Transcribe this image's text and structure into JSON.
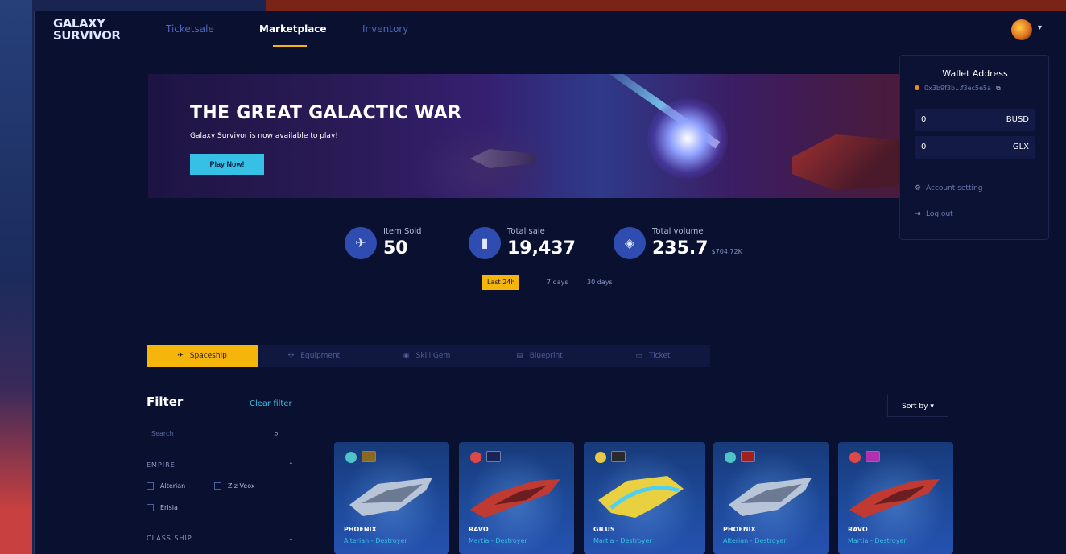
{
  "app": {
    "logo": "GALAXY SURVIVOR"
  },
  "nav": {
    "items": [
      {
        "label": "Ticketsale",
        "active": false
      },
      {
        "label": "Marketplace",
        "active": true
      },
      {
        "label": "Inventory",
        "active": false
      }
    ]
  },
  "banner": {
    "title": "THE GREAT GALACTIC WAR",
    "subtitle": "Galaxy Survivor is now available to play!",
    "button": "Play Now!"
  },
  "wallet": {
    "title": "Wallet Address",
    "address": "0x3b9f3b...f3ec5e5a",
    "balances": [
      {
        "value": "0",
        "unit": "BUSD"
      },
      {
        "value": "0",
        "unit": "GLX"
      }
    ],
    "menu": [
      {
        "label": "Account setting",
        "icon": "gear-icon"
      },
      {
        "label": "Log out",
        "icon": "logout-icon"
      }
    ]
  },
  "stats": [
    {
      "label": "Item Sold",
      "value": "50",
      "sub": "",
      "icon": "spaceship-icon"
    },
    {
      "label": "Total sale",
      "value": "19,437",
      "sub": "",
      "icon": "chart-icon"
    },
    {
      "label": "Total volume",
      "value": "235.7",
      "sub": "$704.72K",
      "icon": "bnb-icon"
    }
  ],
  "time_tabs": [
    {
      "label": "Last 24h",
      "active": true
    },
    {
      "label": "7 days",
      "active": false
    },
    {
      "label": "30 days",
      "active": false
    }
  ],
  "categories": [
    {
      "label": "Spaceship",
      "icon": "spaceship-icon",
      "active": true
    },
    {
      "label": "Equipment",
      "icon": "equipment-icon",
      "active": false
    },
    {
      "label": "Skill Gem",
      "icon": "gem-icon",
      "active": false
    },
    {
      "label": "Blueprint",
      "icon": "blueprint-icon",
      "active": false
    },
    {
      "label": "Ticket",
      "icon": "ticket-icon",
      "active": false
    }
  ],
  "filter": {
    "title": "Filter",
    "clear": "Clear filter",
    "search_placeholder": "Search",
    "sections": [
      {
        "label": "EMPIRE"
      },
      {
        "label": "CLASS SHIP"
      }
    ],
    "checkboxes": [
      {
        "label": "Alterian"
      },
      {
        "label": "Ziz Veox"
      },
      {
        "label": "Erisia"
      }
    ]
  },
  "sort": {
    "label": "Sort by"
  },
  "colors": {
    "accent": "#f5b50a",
    "cyan": "#37c0e6",
    "bg": "#0a1030",
    "card": "#1e4a9a"
  },
  "cards": [
    {
      "name": "PHOENIX",
      "class": "Alterian - Destroyer",
      "element_color": "#4fc3c8",
      "hull": "#b8c4d8"
    },
    {
      "name": "RAVO",
      "class": "Martia - Destroyer",
      "element_color": "#e04848",
      "hull": "#c03a32"
    },
    {
      "name": "GILUS",
      "class": "Martia - Destroyer",
      "element_color": "#e8c84a",
      "hull": "#e8d040"
    },
    {
      "name": "PHOENIX",
      "class": "Alterian - Destroyer",
      "element_color": "#4fc3c8",
      "hull": "#b8c4d8"
    },
    {
      "name": "RAVO",
      "class": "Martia - Destroyer",
      "element_color": "#e04848",
      "hull": "#c03a32"
    }
  ]
}
